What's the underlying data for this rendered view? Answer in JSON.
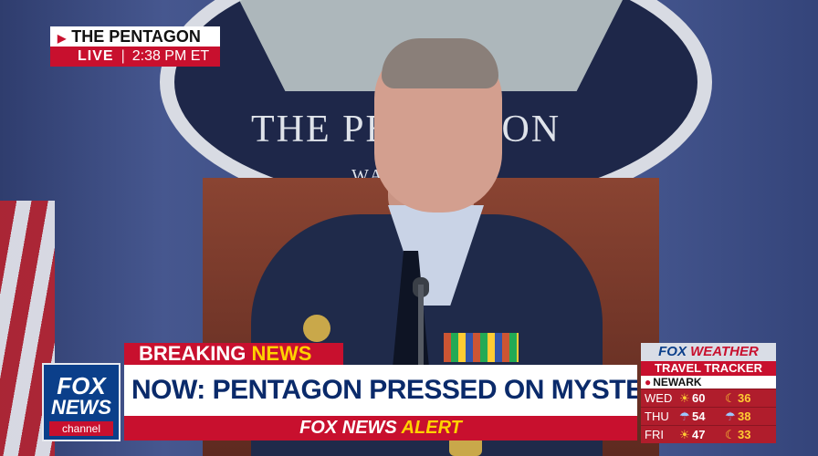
{
  "location_bug": {
    "place": "THE PENTAGON",
    "live_label": "LIVE",
    "time": "2:38 PM ET"
  },
  "backdrop": {
    "seal_title": "THE PENTAGON",
    "seal_subtitle": "WA     GTON"
  },
  "network_logo": {
    "line1": "FOX",
    "line2": "NEWS",
    "line3": "channel"
  },
  "lower_third": {
    "breaking_word1": "BREAKING",
    "breaking_word2": "NEWS",
    "headline": "NOW: PENTAGON PRESSED ON MYSTERIOUS DRONES",
    "alert_word1": "FOX NEWS",
    "alert_word2": "ALERT"
  },
  "weather": {
    "brand_word1": "FOX",
    "brand_word2": "WEATHER",
    "tracker_label": "TRAVEL TRACKER",
    "city": "NEWARK",
    "forecast": [
      {
        "day": "WED",
        "high": "60",
        "low": "36",
        "icon": "sun-icon"
      },
      {
        "day": "THU",
        "high": "54",
        "low": "38",
        "icon": "rain-icon"
      },
      {
        "day": "FRI",
        "high": "47",
        "low": "33",
        "icon": "sun-icon"
      }
    ]
  },
  "colors": {
    "fox_red": "#c8102e",
    "fox_blue": "#0b3f8a",
    "alert_gold": "#ffd200"
  }
}
